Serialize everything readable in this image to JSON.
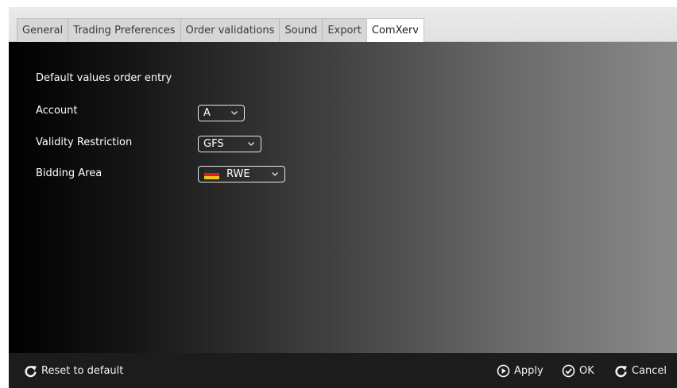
{
  "tabs": [
    {
      "label": "General"
    },
    {
      "label": "Trading Preferences"
    },
    {
      "label": "Order validations"
    },
    {
      "label": "Sound"
    },
    {
      "label": "Export"
    },
    {
      "label": "ComXerv",
      "active": true
    }
  ],
  "section": {
    "title": "Default values order entry"
  },
  "fields": {
    "account": {
      "label": "Account",
      "value": "A"
    },
    "validity": {
      "label": "Validity Restriction",
      "value": "GFS"
    },
    "bidding_area": {
      "label": "Bidding Area",
      "value": "RWE",
      "icon": "germany-flag-icon"
    }
  },
  "footer": {
    "reset_label": "Reset to default",
    "apply_label": "Apply",
    "ok_label": "OK",
    "cancel_label": "Cancel"
  },
  "colors": {
    "flag_black": "#2a2a2a",
    "flag_red": "#d61f1f",
    "flag_gold": "#f0c419",
    "active_tab": "#ffffff"
  }
}
